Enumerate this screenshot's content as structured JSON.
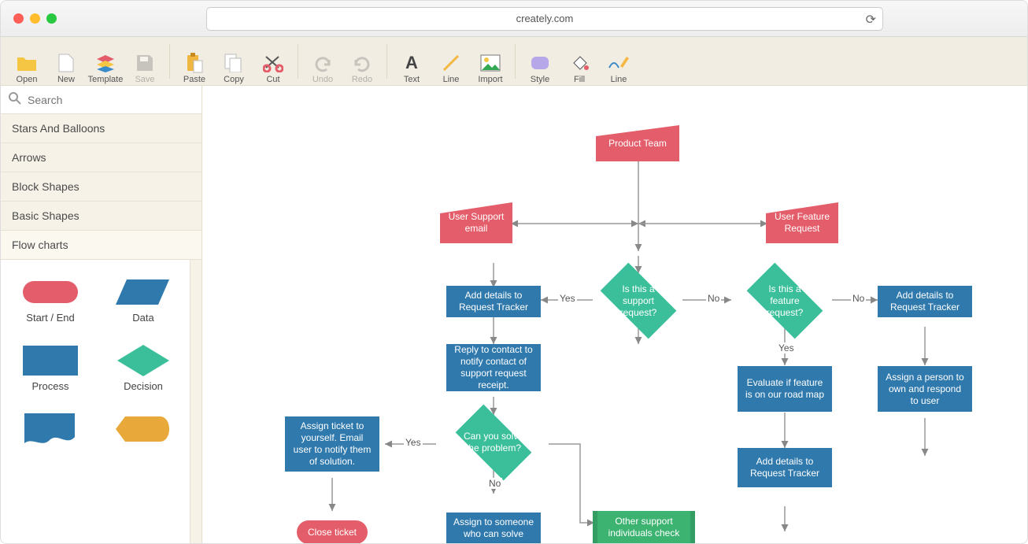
{
  "titlebar": {
    "url": "creately.com"
  },
  "toolbar": {
    "open": "Open",
    "new": "New",
    "template": "Template",
    "save": "Save",
    "paste": "Paste",
    "copy": "Copy",
    "cut": "Cut",
    "undo": "Undo",
    "redo": "Redo",
    "text": "Text",
    "line": "Line",
    "import": "Import",
    "style": "Style",
    "fill": "Fill",
    "line2": "Line"
  },
  "sidebar": {
    "search_placeholder": "Search",
    "categories": [
      "Stars And Balloons",
      "Arrows",
      "Block Shapes",
      "Basic Shapes",
      "Flow charts"
    ],
    "palette": {
      "start_end": "Start / End",
      "data": "Data",
      "process": "Process",
      "decision": "Decision"
    }
  },
  "flow": {
    "product_team": "Product Team",
    "user_support_email": "User Support email",
    "user_feature_request": "User Feature Request",
    "add_details_1": "Add details to Request Tracker",
    "is_support": "Is this a support request?",
    "is_feature": "Is this a feature request?",
    "add_details_2": "Add details to Request Tracker",
    "reply_contact": "Reply to contact to notify contact of support request receipt.",
    "evaluate_feature": "Evaluate if feature is on our road map",
    "assign_person": "Assign a person to own and respond to user",
    "can_solve": "Can you solve the problem?",
    "assign_ticket": "Assign ticket to yourself. Email user to notify them of solution.",
    "add_details_3": "Add details to Request Tracker",
    "close_ticket": "Close ticket",
    "assign_someone": "Assign to someone who can solve",
    "other_support": "Other support individuals check",
    "yes": "Yes",
    "no": "No"
  }
}
